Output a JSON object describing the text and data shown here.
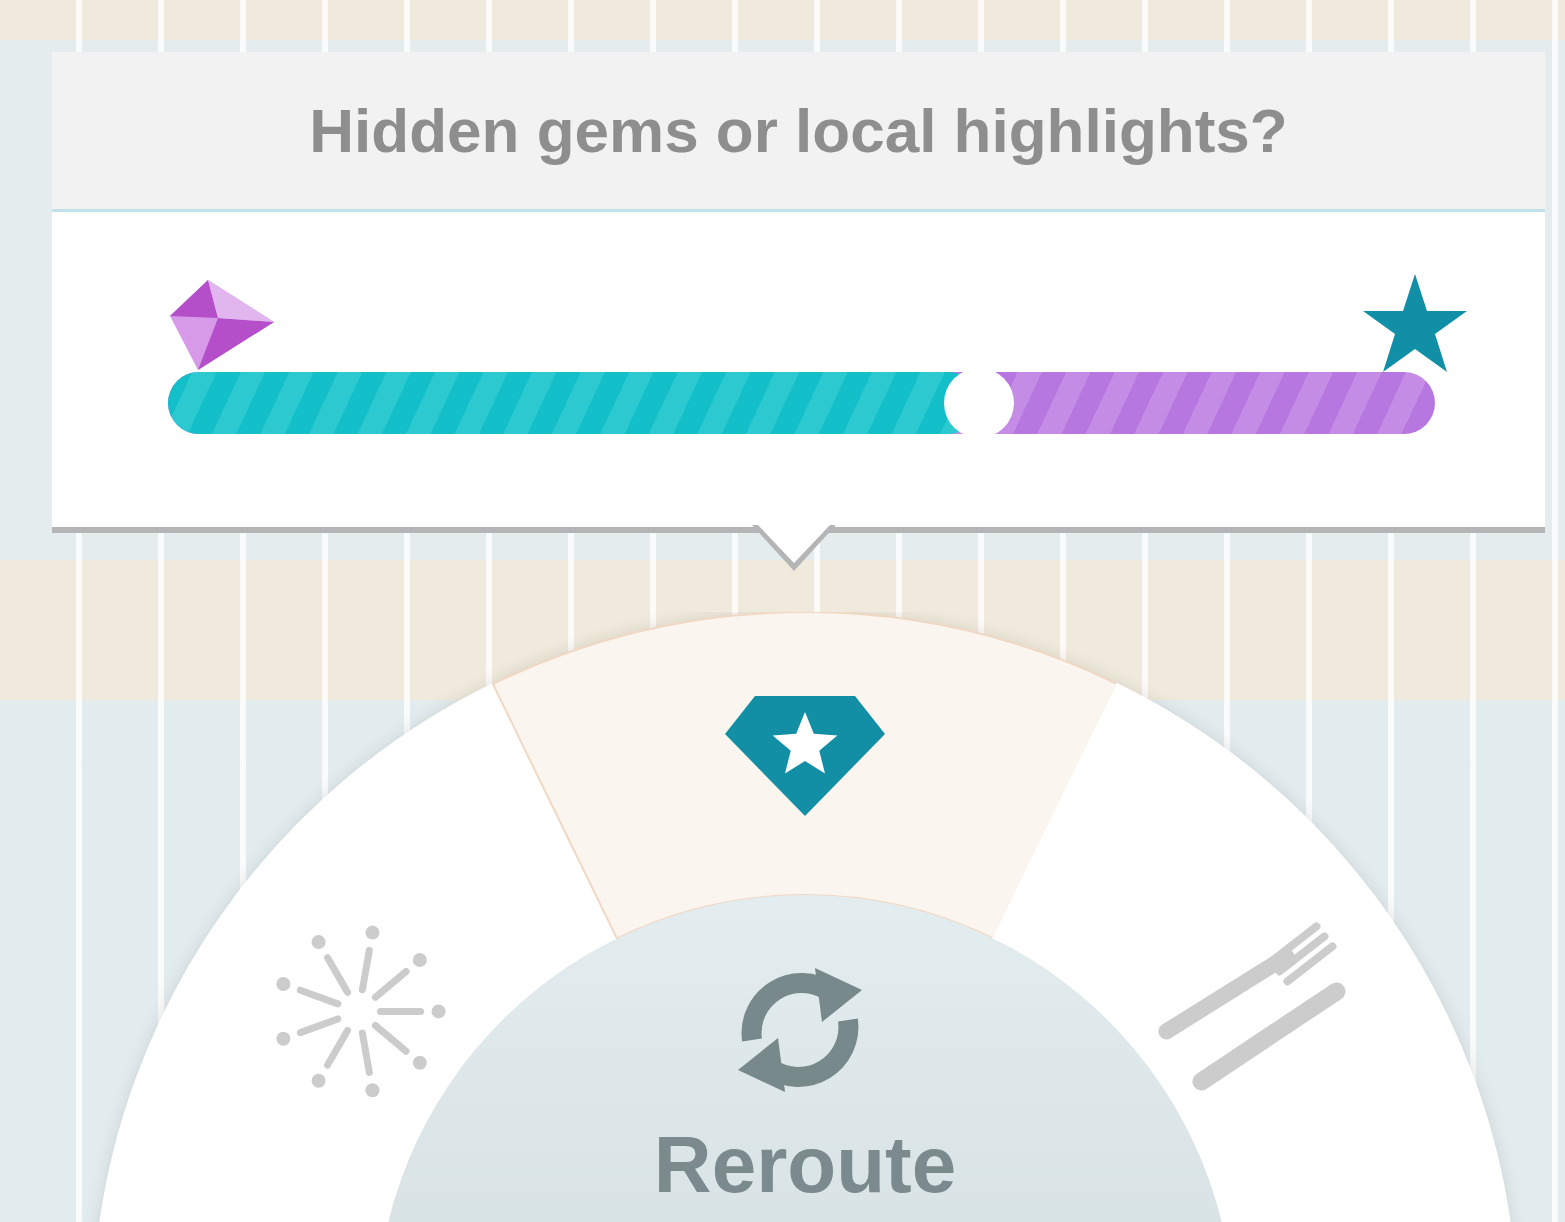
{
  "prompt": {
    "title": "Hidden gems or local highlights?"
  },
  "slider": {
    "level": 0.64
  },
  "menu": {
    "segments": [
      {
        "kind": "events",
        "selected": false
      },
      {
        "kind": "gems",
        "selected": true
      },
      {
        "kind": "food",
        "selected": false
      }
    ],
    "center_button": {
      "label": "Reroute"
    }
  }
}
